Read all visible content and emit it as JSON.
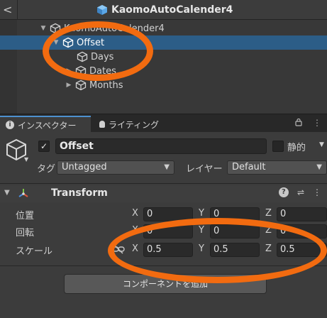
{
  "window": {
    "back": "<",
    "title": "KaomoAutoCalender4"
  },
  "hierarchy": {
    "items": [
      {
        "label": "KaomoAutoCalender4",
        "fold": "▼"
      },
      {
        "label": "Offset",
        "fold": "▼",
        "selected": true
      },
      {
        "label": "Days",
        "fold": ""
      },
      {
        "label": "Dates",
        "fold": "▶"
      },
      {
        "label": "Months",
        "fold": "▶"
      }
    ]
  },
  "tabs": {
    "inspector": "インスペクター",
    "lighting": "ライティング",
    "lock": "🔒",
    "menu": "⋮"
  },
  "object": {
    "active_check": "✓",
    "name": "Offset",
    "static_label": "静的",
    "tag_label": "タグ",
    "tag_value": "Untagged",
    "layer_label": "レイヤー",
    "layer_value": "Default"
  },
  "transform": {
    "title": "Transform",
    "help": "?",
    "settings": "⇌",
    "menu": "⋮",
    "rows": [
      {
        "label": "位置",
        "x": "0",
        "y": "0",
        "z": "0"
      },
      {
        "label": "回転",
        "x": "0",
        "y": "0",
        "z": "0"
      },
      {
        "label": "スケール",
        "x": "0.5",
        "y": "0.5",
        "z": "0.5"
      }
    ],
    "axis_x": "X",
    "axis_y": "Y",
    "axis_z": "Z"
  },
  "add_component": "コンポーネントを追加",
  "colors": {
    "selection": "#2c5d87",
    "annotation": "#f26b10",
    "tab_accent": "#4d90cf"
  }
}
